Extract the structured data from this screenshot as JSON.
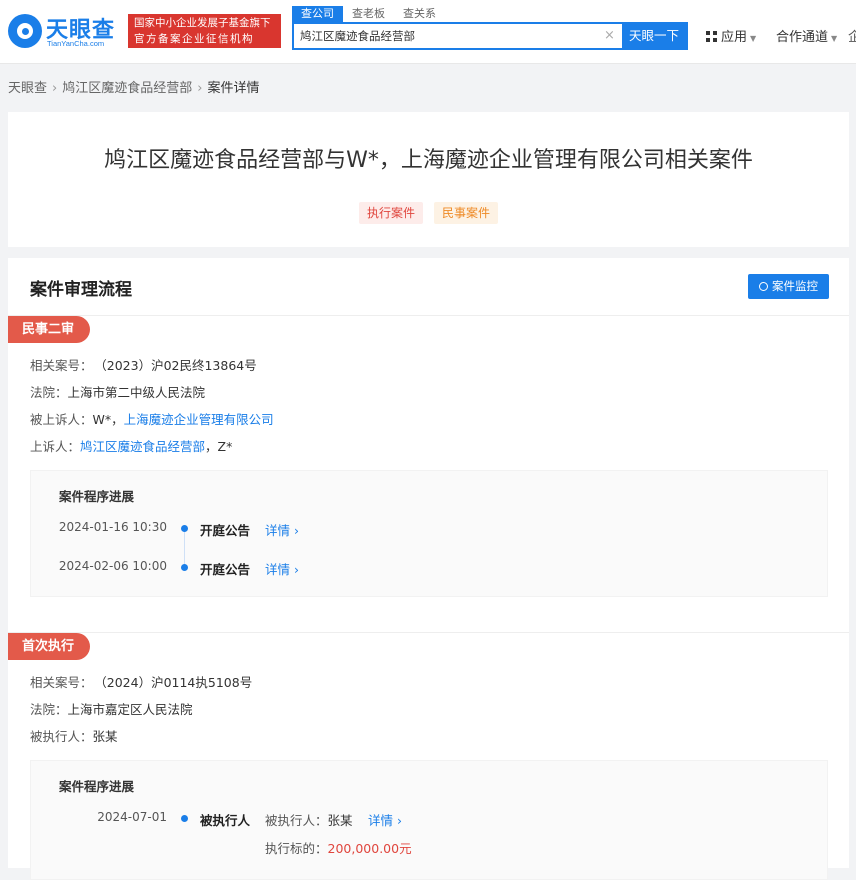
{
  "header": {
    "logo_name": "天眼查",
    "logo_sub": "TianYanCha.com",
    "badge_line1": "国家中小企业发展子基金旗下",
    "badge_line2": "官方备案企业征信机构",
    "search_tabs": [
      "查公司",
      "查老板",
      "查关系"
    ],
    "search_value": "鸠江区魔迹食品经营部",
    "search_button": "天眼一下",
    "nav_apps": "应用",
    "nav_partner": "合作通道"
  },
  "breadcrumb": [
    "天眼查",
    "鸠江区魔迹食品经营部",
    "案件详情"
  ],
  "case": {
    "title": "鸠江区魔迹食品经营部与W*，上海魔迹企业管理有限公司相关案件",
    "tags": [
      "执行案件",
      "民事案件"
    ]
  },
  "process": {
    "title": "案件审理流程",
    "monitor_button": "案件监控",
    "progress_title": "案件程序进展",
    "stages": [
      {
        "name": "民事二审",
        "case_no_label": "相关案号：",
        "case_no": "（2023）沪02民终13864号",
        "court_label": "法院：",
        "court": "上海市第二中级人民法院",
        "appellee_label": "被上诉人：",
        "appellee_plain": "W*，",
        "appellee_link": "上海魔迹企业管理有限公司",
        "appellant_label": "上诉人：",
        "appellant_link": "鸠江区魔迹食品经营部",
        "appellant_plain": "，Z*",
        "events": [
          {
            "date": "2024-01-16 10:30",
            "event": "开庭公告",
            "link": "详情"
          },
          {
            "date": "2024-02-06 10:00",
            "event": "开庭公告",
            "link": "详情"
          }
        ]
      },
      {
        "name": "首次执行",
        "case_no_label": "相关案号：",
        "case_no": "（2024）沪0114执5108号",
        "court_label": "法院：",
        "court": "上海市嘉定区人民法院",
        "executed_label": "被执行人：",
        "executed": "张某",
        "events": [
          {
            "date": "2024-07-01",
            "event": "被执行人",
            "party_label": "被执行人：",
            "party": "张某",
            "link": "详情",
            "amount_label": "执行标的：",
            "amount": "200,000.00元"
          }
        ]
      }
    ]
  },
  "colors": {
    "brand_blue": "#1a7ee8",
    "stage_red": "#e35a4a",
    "badge_red": "#d9362f",
    "amount_red": "#e0463e"
  }
}
